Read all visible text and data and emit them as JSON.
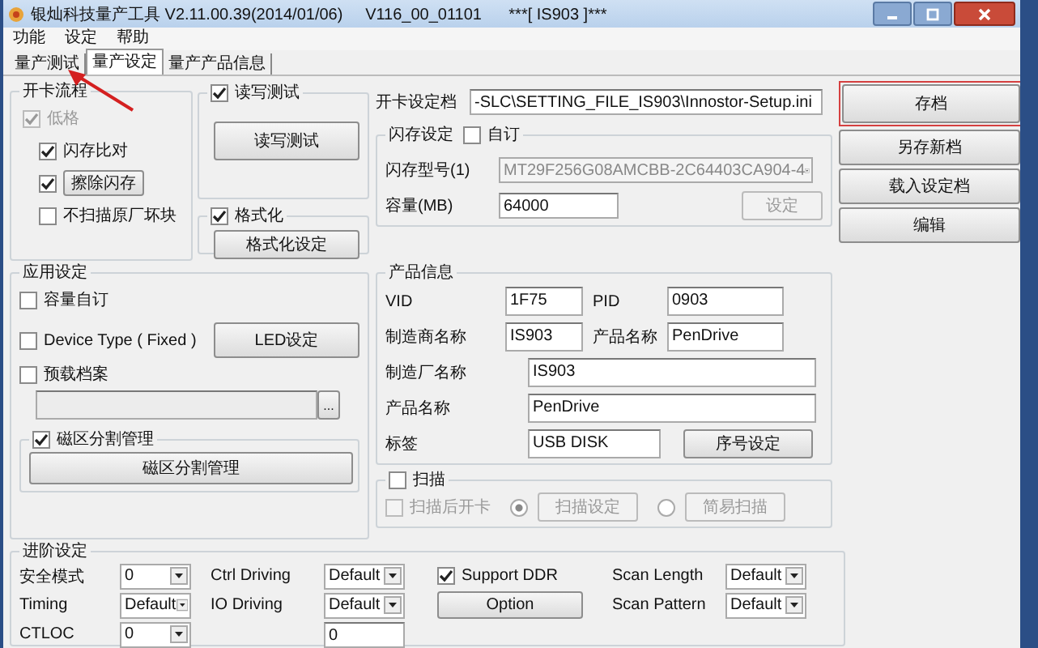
{
  "window": {
    "title": "银灿科技量产工具 V2.11.00.39(2014/01/06)     V116_00_01101      ***[ IS903 ]***"
  },
  "menu": [
    "功能",
    "设定",
    "帮助"
  ],
  "tabs": [
    {
      "label": "量产测试",
      "selected": false
    },
    {
      "label": "量产设定",
      "selected": true
    },
    {
      "label": "量产产品信息",
      "selected": false
    }
  ],
  "card_flow": {
    "title": "开卡流程",
    "items": [
      {
        "kind": "check",
        "label": "低格",
        "checked": true,
        "disabled": true
      },
      {
        "kind": "check",
        "label": "闪存比对",
        "checked": true,
        "disabled": false
      },
      {
        "kind": "check_button",
        "label": "擦除闪存",
        "checked": true,
        "disabled": false
      },
      {
        "kind": "check",
        "label": "不扫描原厂坏块",
        "checked": false,
        "disabled": false
      }
    ]
  },
  "rw_test": {
    "label": "读写测试",
    "checked": true,
    "button": "读写测试"
  },
  "format": {
    "label": "格式化",
    "checked": true,
    "button": "格式化设定"
  },
  "settings_file": {
    "label": "开卡设定档",
    "value": "-SLC\\SETTING_FILE_IS903\\Innostor-Setup.ini"
  },
  "flash": {
    "title": "闪存设定",
    "custom": {
      "label": "自订",
      "checked": false
    },
    "model_label": "闪存型号(1)",
    "model_value": "MT29F256G08AMCBB-2C64403CA904-4",
    "capacity_label": "容量(MB)",
    "capacity_value": "64000",
    "set_button": {
      "label": "设定",
      "disabled": true
    }
  },
  "side_buttons": [
    {
      "label": "存档",
      "highlighted": true
    },
    {
      "label": "另存新档",
      "highlighted": false
    },
    {
      "label": "载入设定档",
      "highlighted": false
    },
    {
      "label": "编辑",
      "highlighted": false
    }
  ],
  "app": {
    "title": "应用设定",
    "capacity_custom": {
      "label": "容量自订",
      "checked": false
    },
    "device_type": {
      "label": "Device Type ( Fixed )",
      "checked": false
    },
    "led_button": "LED设定",
    "preload": {
      "label": "预载档案",
      "checked": false
    },
    "browse_button": "...",
    "partition": {
      "label": "磁区分割管理",
      "checked": true,
      "button": "磁区分割管理"
    }
  },
  "product": {
    "title": "产品信息",
    "fields": [
      {
        "label": "VID",
        "value": "1F75"
      },
      {
        "label": "PID",
        "value": "0903"
      },
      {
        "label": "制造商名称",
        "value": "IS903"
      },
      {
        "label": "产品名称",
        "value": "PenDrive"
      }
    ],
    "wide_fields": [
      {
        "label": "制造厂名称",
        "value": "IS903"
      },
      {
        "label": "产品名称",
        "value": "PenDrive"
      }
    ],
    "tag": {
      "label": "标签",
      "value": "USB DISK"
    },
    "serial_button": "序号设定"
  },
  "scan": {
    "label": "扫描",
    "checked": false,
    "disabled": true,
    "open_after": {
      "label": "扫描后开卡",
      "checked": false
    },
    "options": [
      {
        "label": "扫描设定",
        "selected": true
      },
      {
        "label": "简易扫描",
        "selected": false
      }
    ]
  },
  "advanced": {
    "title": "进阶设定",
    "rows": [
      [
        {
          "kind": "select",
          "label": "安全模式",
          "value": "0"
        },
        {
          "kind": "select",
          "label": "Ctrl Driving",
          "value": "Default"
        },
        {
          "kind": "check",
          "label": "Support DDR",
          "checked": true
        },
        {
          "kind": "select",
          "label": "Scan Length",
          "value": "Default"
        }
      ],
      [
        {
          "kind": "select",
          "label": "Timing",
          "value": "Default"
        },
        {
          "kind": "select",
          "label": "IO Driving",
          "value": "Default"
        },
        {
          "kind": "button",
          "label": "Option"
        },
        {
          "kind": "select",
          "label": "Scan Pattern",
          "value": "Default"
        }
      ],
      [
        {
          "kind": "select",
          "label": "CTLOC",
          "value": "0"
        },
        {
          "kind": "input",
          "value": "0"
        }
      ]
    ]
  }
}
